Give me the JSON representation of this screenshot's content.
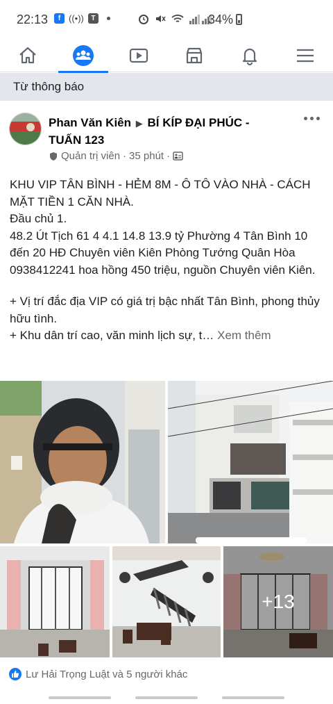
{
  "status_bar": {
    "time": "22:13",
    "battery": "34%",
    "icons": [
      "notification-icon",
      "podcast-icon",
      "app-icon",
      "dot",
      "alarm-icon",
      "mute-icon",
      "wifi-icon",
      "signal-icon"
    ]
  },
  "nav": {
    "items": [
      "home-icon",
      "groups-icon",
      "watch-icon",
      "marketplace-icon",
      "notifications-icon",
      "menu-icon"
    ],
    "active": "groups-icon",
    "accent": "#1877f2"
  },
  "section": {
    "title": "Từ thông báo"
  },
  "post": {
    "author": "Phan Văn Kiên",
    "group": "BÍ KÍP ĐẠI PHÚC - TUẤN 123",
    "role": "Quản trị viên",
    "time": "35 phút",
    "body": {
      "line1": "KHU VIP TÂN BÌNH - HẺM 8M - Ô TÔ VÀO NHÀ - CÁCH MẶT TIỀN 1 CĂN NHÀ.",
      "line2": "Đầu chủ 1.",
      "line3": "48.2 Út Tịch 61 4 4.1 14.8 13.9 tỷ Phường 4 Tân Bình 10 đến 20 HĐ Chuyên viên Kiên Phòng Tướng Quân Hòa 0938412241 hoa hồng 450 triệu, nguồn Chuyên viên Kiên.",
      "line4": "+ Vị trí đắc địa VIP có giá trị bậc nhất Tân Bình, phong thủy hữu tình.",
      "line5": "+ Khu dân trí cao, văn minh lịch sự, t…",
      "see_more": "Xem thêm"
    },
    "photos": {
      "more_count": "+13"
    },
    "reactions": "Lư Hải Trọng Luật và 5 người khác"
  }
}
